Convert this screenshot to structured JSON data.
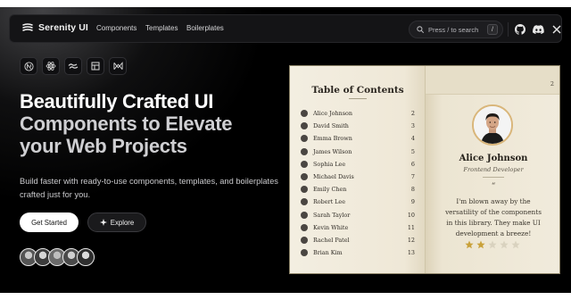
{
  "navbar": {
    "brand": "Serenity UI",
    "links": [
      "Components",
      "Templates",
      "Boilerplates"
    ],
    "search_placeholder": "Press / to search",
    "search_shortcut": "/"
  },
  "tech_icons": [
    "nextjs-icon",
    "react-icon",
    "tailwind-icon",
    "shadcn-icon",
    "framer-motion-icon"
  ],
  "hero": {
    "line1": "Beautifully Crafted UI",
    "line2": "Components to Elevate",
    "line3": "your Web Projects",
    "subtitle": "Build faster with ready-to-use components, templates, and boilerplates crafted just for you.",
    "primary_button": "Get Started",
    "secondary_button": "Explore"
  },
  "book": {
    "toc_title": "Table of Contents",
    "toc": [
      {
        "name": "Alice Johnson",
        "page": "2"
      },
      {
        "name": "David Smith",
        "page": "3"
      },
      {
        "name": "Emma Brown",
        "page": "4"
      },
      {
        "name": "James Wilson",
        "page": "5"
      },
      {
        "name": "Sophia Lee",
        "page": "6"
      },
      {
        "name": "Michael Davis",
        "page": "7"
      },
      {
        "name": "Emily Chen",
        "page": "8"
      },
      {
        "name": "Robert Lee",
        "page": "9"
      },
      {
        "name": "Sarah Taylor",
        "page": "10"
      },
      {
        "name": "Kevin White",
        "page": "11"
      },
      {
        "name": "Rachel Patel",
        "page": "12"
      },
      {
        "name": "Brian Kim",
        "page": "13"
      }
    ],
    "page_number": "2",
    "person_name": "Alice Johnson",
    "person_role": "Frontend Developer",
    "quote_mark": "“",
    "quote": "I'm blown away by the versatility of the components in this library. They make UI development a breeze!",
    "rating": 2,
    "rating_max": 5
  },
  "colors": {
    "star_filled": "#c9a13a",
    "star_empty": "#d9d2bf",
    "portrait_ring": "#d9b67a"
  }
}
